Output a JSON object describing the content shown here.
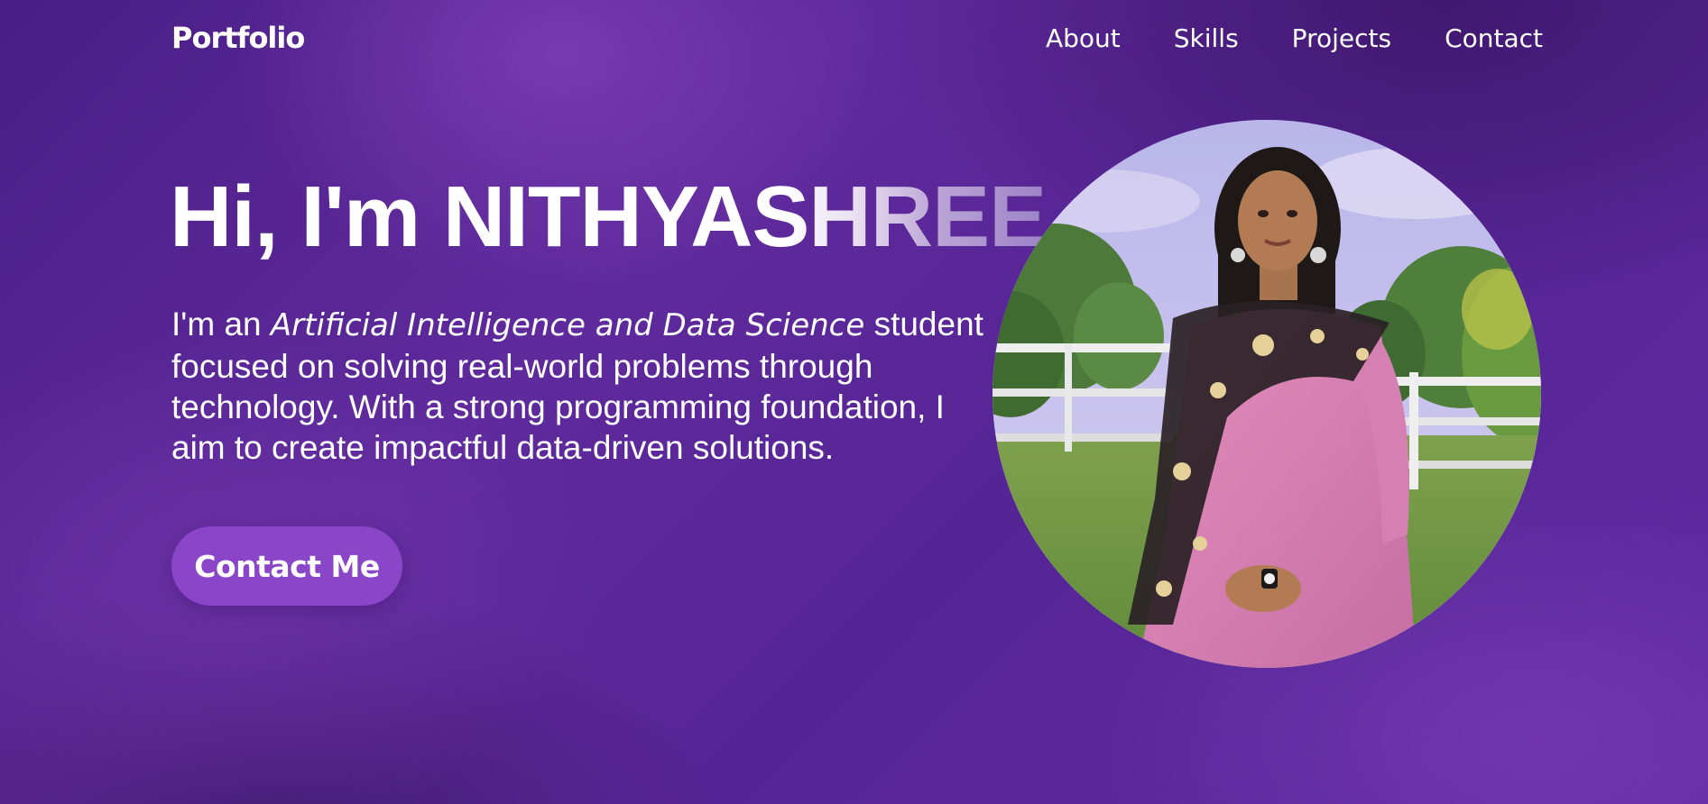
{
  "nav": {
    "logo": "Portfolio",
    "links": [
      "About",
      "Skills",
      "Projects",
      "Contact"
    ]
  },
  "hero": {
    "title": "Hi, I'm NITHYASHREE",
    "description": {
      "intro": "I'm an ",
      "emphasis": "Artificial Intelligence and Data Science",
      "rest": " student focused on solving real-world problems through technology. With a strong programming foundation, I aim to create impactful data-driven solutions."
    },
    "cta_label": "Contact Me"
  },
  "colors": {
    "background": "#5a2796",
    "button": "#8a45c9",
    "text": "#ffffff"
  }
}
